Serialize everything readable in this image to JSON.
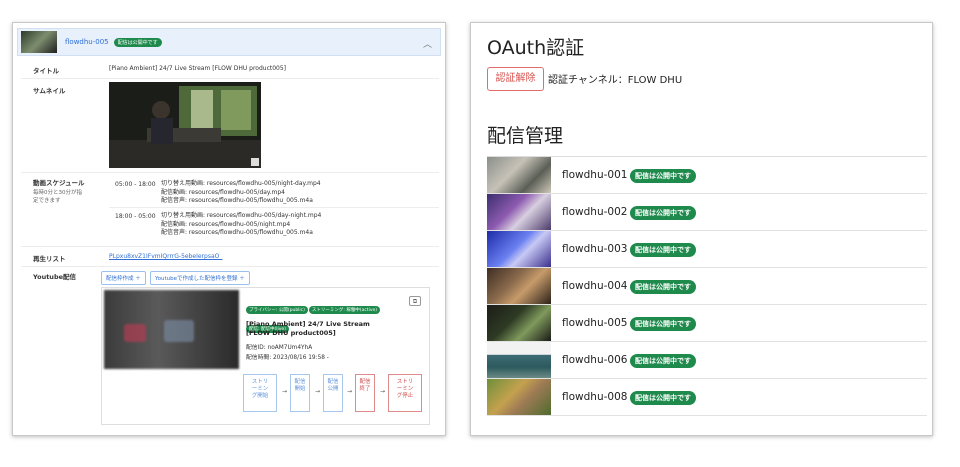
{
  "left": {
    "header": {
      "name": "flowdhu-005",
      "badge": "配信は公開中です"
    },
    "title_label": "タイトル",
    "title_value": "[Piano Ambient] 24/7 Live Stream [FLOW DHU product005]",
    "thumbnail_label": "サムネイル",
    "schedule": {
      "label": "動画スケジュール",
      "note_line1": "毎時0分と30分が指",
      "note_line2": "定できます",
      "entries": [
        {
          "time": "05:00 - 18:00",
          "line1": "切り替え用動画: resources/flowdhu-005/night-day.mp4",
          "line2": "配信動画: resources/flowdhu-005/day.mp4",
          "line3": "配信音声: resources/flowdhu-005/flowdhu_005.m4a"
        },
        {
          "time": "18:00 - 05:00",
          "line1": "切り替え用動画: resources/flowdhu-005/day-night.mp4",
          "line2": "配信動画: resources/flowdhu-005/night.mp4",
          "line3": "配信音声: resources/flowdhu-005/flowdhu_005.m4a"
        }
      ]
    },
    "playlist": {
      "label": "再生リスト",
      "value": "PLpxu8xvZ1IFvmIQrrrG-5ebeIerpsaO_"
    },
    "youtube": {
      "label": "Youtube配信",
      "btn_create": "配信枠作成 ＋",
      "btn_register": "Youtubeで作成した配信枠を登録 ＋",
      "badges": [
        "プライバシー: 公開(public)",
        "ストリーミング: 稼働中(active)",
        "配信: 配信中(live)"
      ],
      "stream_title": "[Piano Ambient] 24/7 Live Stream [FLOW DHU product005]",
      "stream_id": "配信ID: noAM7Um4YhA",
      "stream_time": "配信時間: 2023/08/16 19:58 -",
      "steps": [
        "ストリ\nーミン\nグ開始",
        "配信\n開始",
        "配信\n公開",
        "配信\n終了",
        "ストリ\nーミン\nグ停止"
      ]
    }
  },
  "right": {
    "oauth_title": "OAuth認証",
    "unauth_button": "認証解除",
    "channel_text": "認証チャンネル：FLOW DHU",
    "manage_title": "配信管理",
    "streams": [
      {
        "name": "flowdhu-001",
        "badge": "配信は公開中です"
      },
      {
        "name": "flowdhu-002",
        "badge": "配信は公開中です"
      },
      {
        "name": "flowdhu-003",
        "badge": "配信は公開中です"
      },
      {
        "name": "flowdhu-004",
        "badge": "配信は公開中です"
      },
      {
        "name": "flowdhu-005",
        "badge": "配信は公開中です"
      },
      {
        "name": "flowdhu-006",
        "badge": "配信は公開中です"
      },
      {
        "name": "flowdhu-008",
        "badge": "配信は公開中です"
      }
    ]
  }
}
